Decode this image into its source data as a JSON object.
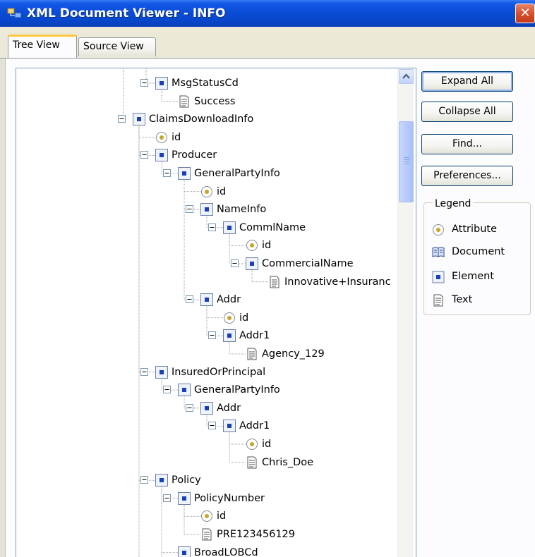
{
  "window": {
    "title": "XML Document Viewer - INFO",
    "close_glyph": "✕"
  },
  "tabs": [
    {
      "label": "Tree View",
      "active": true
    },
    {
      "label": "Source View",
      "active": false
    }
  ],
  "tree": {
    "nodes": [
      {
        "label": "MsgStatusCd",
        "type": "element",
        "depth": 2
      },
      {
        "label": "Success",
        "type": "text",
        "depth": 3
      },
      {
        "label": "ClaimsDownloadInfo",
        "type": "element",
        "depth": 1
      },
      {
        "label": "id",
        "type": "attribute",
        "depth": 2
      },
      {
        "label": "Producer",
        "type": "element",
        "depth": 2
      },
      {
        "label": "GeneralPartyInfo",
        "type": "element",
        "depth": 3
      },
      {
        "label": "id",
        "type": "attribute",
        "depth": 4
      },
      {
        "label": "NameInfo",
        "type": "element",
        "depth": 4
      },
      {
        "label": "CommlName",
        "type": "element",
        "depth": 5
      },
      {
        "label": "id",
        "type": "attribute",
        "depth": 6
      },
      {
        "label": "CommercialName",
        "type": "element",
        "depth": 6
      },
      {
        "label": "Innovative+Insuranc",
        "type": "text",
        "depth": 7
      },
      {
        "label": "Addr",
        "type": "element",
        "depth": 4
      },
      {
        "label": "id",
        "type": "attribute",
        "depth": 5
      },
      {
        "label": "Addr1",
        "type": "element",
        "depth": 5
      },
      {
        "label": "Agency_129",
        "type": "text",
        "depth": 6
      },
      {
        "label": "InsuredOrPrincipal",
        "type": "element",
        "depth": 2
      },
      {
        "label": "GeneralPartyInfo",
        "type": "element",
        "depth": 3
      },
      {
        "label": "Addr",
        "type": "element",
        "depth": 4
      },
      {
        "label": "Addr1",
        "type": "element",
        "depth": 5
      },
      {
        "label": "id",
        "type": "attribute",
        "depth": 6
      },
      {
        "label": "Chris_Doe",
        "type": "text",
        "depth": 6
      },
      {
        "label": "Policy",
        "type": "element",
        "depth": 2
      },
      {
        "label": "PolicyNumber",
        "type": "element",
        "depth": 3
      },
      {
        "label": "id",
        "type": "attribute",
        "depth": 4
      },
      {
        "label": "PRE123456129",
        "type": "text",
        "depth": 4
      },
      {
        "label": "BroadLOBCd",
        "type": "element",
        "depth": 3
      }
    ]
  },
  "buttons": {
    "expand_all": "Expand All",
    "collapse_all": "Collapse All",
    "find": "Find...",
    "preferences": "Preferences..."
  },
  "legend": {
    "title": "Legend",
    "items": [
      {
        "label": "Attribute",
        "icon": "attribute-icon"
      },
      {
        "label": "Document",
        "icon": "document-icon"
      },
      {
        "label": "Element",
        "icon": "element-icon"
      },
      {
        "label": "Text",
        "icon": "text-icon"
      }
    ]
  },
  "colors": {
    "titlebar": "#0a4dd8",
    "element_dot": "#1a3fb8",
    "attribute_dot": "#c8a42a"
  }
}
